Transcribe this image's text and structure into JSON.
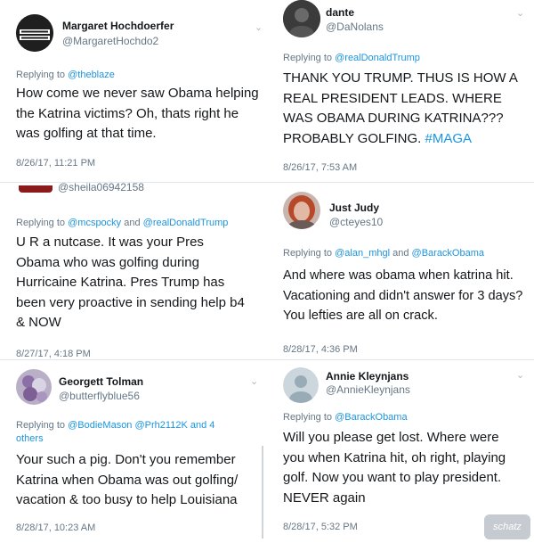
{
  "tweets": [
    {
      "name": "Margaret Hochdoerfer",
      "handle": "@MargaretHochdo2",
      "replying_prefix": "Replying to",
      "mentions": [
        "@theblaze"
      ],
      "body": "How come we never saw Obama helping the Katrina victims? Oh, thats right he was golfing at that time.",
      "time": "8/26/17, 11:21 PM",
      "avatar_text": "SAVE HAD ENOUGH"
    },
    {
      "name": "dante",
      "handle": "@DaNolans",
      "replying_prefix": "Replying to",
      "mentions": [
        "@realDonaldTrump"
      ],
      "body": "THANK YOU TRUMP.  THUS IS HOW A REAL PRESIDENT LEADS.  WHERE WAS OBAMA DURING KATRINA??? PROBABLY GOLFING.",
      "hashtag": "#MAGA",
      "time": "8/26/17, 7:53 AM"
    },
    {
      "handle": "@sheila06942158",
      "replying_prefix": "Replying to",
      "mentions": [
        "@mcspocky",
        "@realDonaldTrump"
      ],
      "joiner": "and",
      "body": "U R a nutcase. It was your Pres Obama who was golfing during Hurricaine Katrina. Pres Trump has been very proactive in sending help b4 & NOW",
      "time": "8/27/17, 4:18 PM"
    },
    {
      "name": "Just Judy",
      "handle": "@cteyes10",
      "replying_prefix": "Replying to",
      "mentions": [
        "@alan_mhgl",
        "@BarackObama"
      ],
      "joiner": "and",
      "body": "And where was obama when katrina hit. Vacationing and didn't answer for 3 days? You lefties are all on crack.",
      "time": "8/28/17, 4:36 PM"
    },
    {
      "name": "Georgett Tolman",
      "handle": "@butterflyblue56",
      "replying_prefix": "Replying to",
      "mentions": [
        "@BodieMason",
        "@Prh2112K"
      ],
      "joiner": "and 4",
      "joiner2": "others",
      "body": "Your such a pig. Don't you remember Katrina when Obama was out golfing/ vacation & too busy to help Louisiana",
      "time": "8/28/17, 10:23 AM"
    },
    {
      "name": "Annie Kleynjans",
      "handle": "@AnnieKleynjans",
      "replying_prefix": "Replying to",
      "mentions": [
        "@BarackObama"
      ],
      "body": "Will you please get lost.  Where were you when Katrina hit, oh right, playing golf. Now you want to play president.  NEVER again",
      "time": "8/28/17, 5:32 PM"
    }
  ],
  "watermark": "schatz",
  "icons": {
    "caret": "chevron-down-icon"
  }
}
